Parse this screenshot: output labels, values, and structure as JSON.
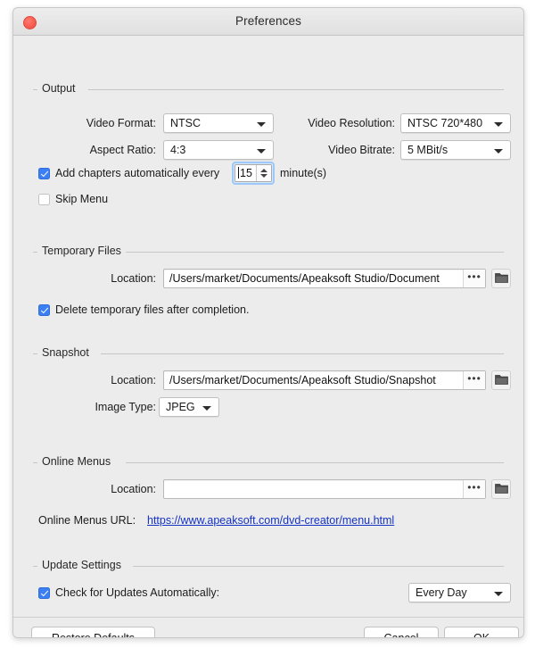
{
  "window": {
    "title": "Preferences",
    "close_button": "close"
  },
  "sections": {
    "output": {
      "legend": "Output",
      "video_format": {
        "label": "Video Format:",
        "value": "NTSC"
      },
      "aspect_ratio": {
        "label": "Aspect Ratio:",
        "value": "4:3"
      },
      "video_resolution": {
        "label": "Video Resolution:",
        "value": "NTSC 720*480"
      },
      "video_bitrate": {
        "label": "Video Bitrate:",
        "value": "5 MBit/s"
      },
      "add_chapters": {
        "checked_label": "Add chapters automatically every",
        "value": "15",
        "unit": "minute(s)",
        "checked": "true"
      },
      "skip_menu": {
        "label": "Skip Menu",
        "checked": "false"
      }
    },
    "temporary_files": {
      "legend": "Temporary Files",
      "location_label": "Location:",
      "location_value": "/Users/market/Documents/Apeaksoft Studio/Document",
      "browse_dots": "•••",
      "delete_temp": {
        "label": "Delete temporary files after completion.",
        "checked": "true"
      }
    },
    "snapshot": {
      "legend": "Snapshot",
      "location_label": "Location:",
      "location_value": "/Users/market/Documents/Apeaksoft Studio/Snapshot",
      "browse_dots": "•••",
      "image_type_label": "Image Type:",
      "image_type_value": "JPEG"
    },
    "online_menus": {
      "legend": "Online Menus",
      "location_label": "Location:",
      "location_value": "",
      "location_placeholder": "",
      "browse_dots": "•••",
      "url_label": "Online Menus URL:",
      "url_value": "https://www.apeaksoft.com/dvd-creator/menu.html"
    },
    "update_settings": {
      "legend": "Update Settings",
      "check_updates": {
        "label": "Check for Updates Automatically:",
        "checked": "true"
      },
      "frequency_value": "Every Day"
    }
  },
  "footer": {
    "restore_defaults": "Restore Defaults",
    "cancel": "Cancel",
    "ok": "OK"
  },
  "icons": {
    "folder": "folder-icon",
    "chevron_down": "chevron-down-icon"
  },
  "colors": {
    "accent": "#3c7ff2",
    "link": "#1433c4",
    "window_bg": "#ececec",
    "close_dot": "#f95d52",
    "focus_ring": "#9ec8f7"
  }
}
